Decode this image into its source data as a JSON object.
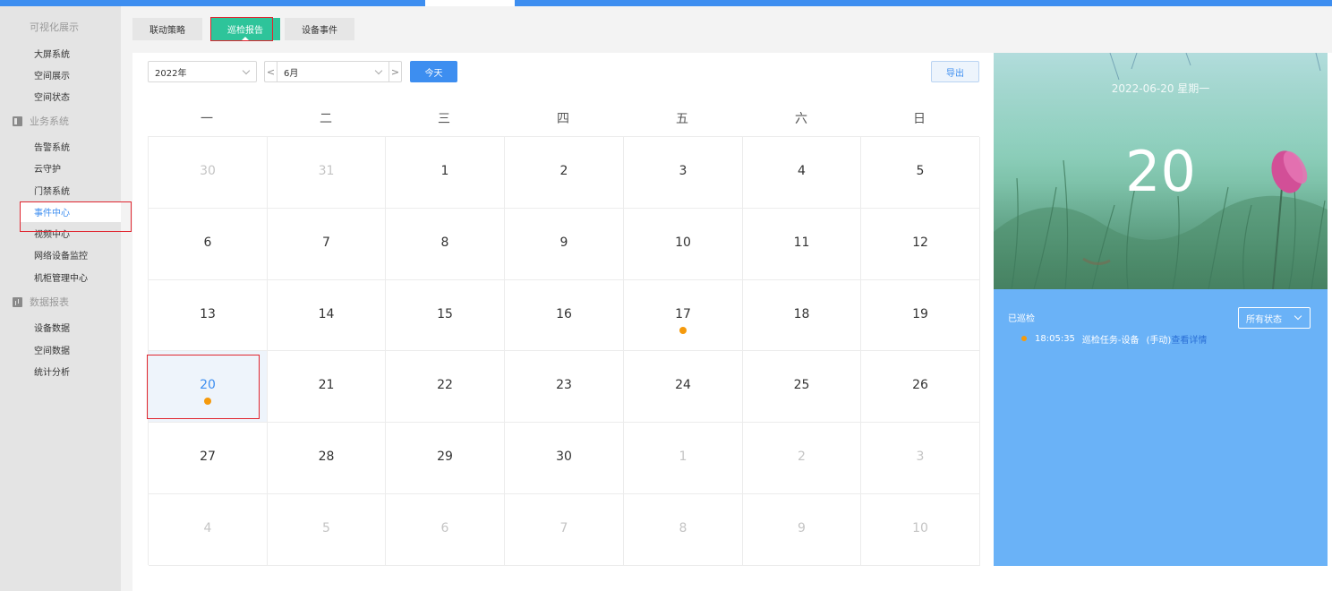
{
  "sidebar": {
    "groups": [
      {
        "label": "可视化展示",
        "icon": "grid-icon",
        "items": [
          "大屏系统",
          "空间展示",
          "空间状态"
        ]
      },
      {
        "label": "业务系统",
        "icon": "board-icon",
        "items": [
          "告警系统",
          "云守护",
          "门禁系统",
          "事件中心",
          "视频中心",
          "网络设备监控",
          "机柜管理中心"
        ]
      },
      {
        "label": "数据报表",
        "icon": "bar-chart-icon",
        "items": [
          "设备数据",
          "空间数据",
          "统计分析"
        ]
      }
    ],
    "active_item": "事件中心"
  },
  "tabs": [
    "联动策略",
    "巡检报告",
    "设备事件"
  ],
  "active_tab": "巡检报告",
  "toolbar": {
    "year": "2022年",
    "prev": "<",
    "month": "6月",
    "next": ">",
    "today": "今天",
    "export": "导出"
  },
  "calendar": {
    "weekdays": [
      "一",
      "二",
      "三",
      "四",
      "五",
      "六",
      "日"
    ],
    "weeks": [
      [
        {
          "d": "30",
          "o": true
        },
        {
          "d": "31",
          "o": true
        },
        {
          "d": "1"
        },
        {
          "d": "2"
        },
        {
          "d": "3"
        },
        {
          "d": "4"
        },
        {
          "d": "5"
        }
      ],
      [
        {
          "d": "6"
        },
        {
          "d": "7"
        },
        {
          "d": "8"
        },
        {
          "d": "9"
        },
        {
          "d": "10"
        },
        {
          "d": "11"
        },
        {
          "d": "12"
        }
      ],
      [
        {
          "d": "13"
        },
        {
          "d": "14"
        },
        {
          "d": "15"
        },
        {
          "d": "16"
        },
        {
          "d": "17",
          "dot": true
        },
        {
          "d": "18"
        },
        {
          "d": "19"
        }
      ],
      [
        {
          "d": "20",
          "dot": true,
          "selected": true
        },
        {
          "d": "21"
        },
        {
          "d": "22"
        },
        {
          "d": "23"
        },
        {
          "d": "24"
        },
        {
          "d": "25"
        },
        {
          "d": "26"
        }
      ],
      [
        {
          "d": "27"
        },
        {
          "d": "28"
        },
        {
          "d": "29"
        },
        {
          "d": "30"
        },
        {
          "d": "1",
          "o": true
        },
        {
          "d": "2",
          "o": true
        },
        {
          "d": "3",
          "o": true
        }
      ],
      [
        {
          "d": "4",
          "o": true
        },
        {
          "d": "5",
          "o": true
        },
        {
          "d": "6",
          "o": true
        },
        {
          "d": "7",
          "o": true
        },
        {
          "d": "8",
          "o": true
        },
        {
          "d": "9",
          "o": true
        },
        {
          "d": "10",
          "o": true
        }
      ]
    ],
    "dot_color": "#f59a0c"
  },
  "detail": {
    "date_line": "2022-06-20  星期一",
    "day": "20",
    "section_title": "已巡检",
    "status_filter": "所有状态",
    "entry": {
      "time": "18:05:35",
      "text": "巡检任务-设备",
      "mode": "(手动)",
      "link": "查看详情"
    }
  },
  "colors": {
    "accent": "#3d8ef0",
    "tab_active": "#2ec49a",
    "panel_blue": "#6ab2f7",
    "highlight": "#e0252f"
  }
}
